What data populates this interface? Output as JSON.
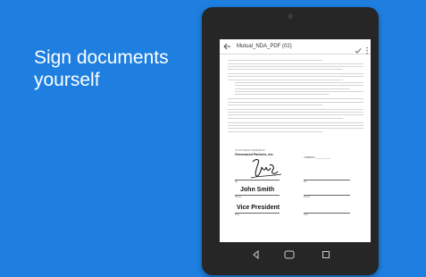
{
  "headline": {
    "line1": "Sign documents",
    "line2": "yourself"
  },
  "colors": {
    "background": "#1e7fe0",
    "device": "#262626",
    "screen": "#ffffff"
  },
  "app": {
    "title": "Mutual_NDA_PDF (02)",
    "back_icon": "arrow-left-icon",
    "confirm_icon": "check-icon",
    "menu_icon": "more-vert-icon"
  },
  "document": {
    "witness_label": "IN WITNESS WHEREOF",
    "company": "Greenwood Partners, Inc.",
    "counterparty_label": "COMPANY: ___________",
    "name": "John Smith",
    "title": "Vice President",
    "field_labels": {
      "by": "By:",
      "date": "Date:",
      "name": "Name:",
      "title": "Title:"
    }
  },
  "navbar": {
    "back_icon": "nav-back-icon",
    "home_icon": "nav-home-icon",
    "recents_icon": "nav-recents-icon"
  }
}
